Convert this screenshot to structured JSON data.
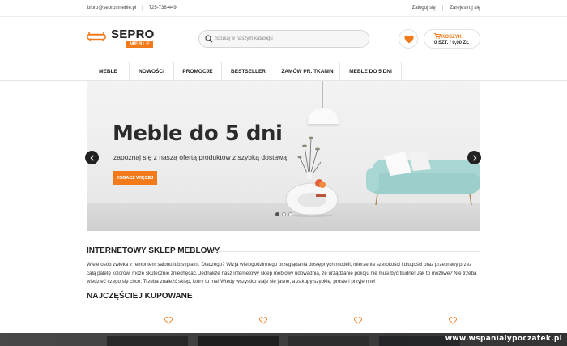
{
  "topbar": {
    "email": "biuro@seprosmeble.pl",
    "phone": "725-738-449",
    "login": "Zaloguj się",
    "register": "Zarejestruj się"
  },
  "logo": {
    "brand": "SEPRO",
    "sub": "MEBLE"
  },
  "search": {
    "placeholder": "Szukaj w naszym katalogu"
  },
  "cart": {
    "label": "KOSZYK",
    "summary": "0 SZT. / 0,00 ZŁ"
  },
  "nav": {
    "items": [
      {
        "label": "MEBLE"
      },
      {
        "label": "NOWOŚCI"
      },
      {
        "label": "PROMOCJE"
      },
      {
        "label": "BESTSELLER"
      },
      {
        "label": "ZAMÓW PR. TKANIN"
      },
      {
        "label": "MEBLE DO 5 DNI"
      }
    ]
  },
  "hero": {
    "title": "Meble do 5 dni",
    "subtitle": "zapoznaj się z naszą ofertą produktów z szybką dostawą",
    "cta": "ZOBACZ WIĘCEJ",
    "slide_count": 3,
    "active_slide": 1
  },
  "section1": {
    "title": "INTERNETOWY SKLEP MEBLOWY",
    "text": "Wiele osób zwleka z remontem salonu lub sypialni. Dlaczego? Wizja wielogodzinnego przeglądania dostępnych modeli, mierzenia szerokości i długości oraz przeprawy przez całą paletę kolorów, może skutecznie zniechęcać. Jednakże nasz internetowy sklep meblowy udowadnia, że urządzanie pokoju nie musi być trudne! Jak to możliwe? Nie trzeba wiedzieć czego się chce. Trzeba znaleźć sklep, który to ma! Wtedy wszystko staje się jasne, a zakupy szybkie, proste i przyjemne!"
  },
  "section2": {
    "title": "NAJCZĘŚCIEJ KUPOWANE"
  },
  "watermark": {
    "text": "www.wspanialypoczatek.pl"
  },
  "colors": {
    "accent": "#f27a1a",
    "dark": "#222222",
    "sofa": "#a8d6d3"
  }
}
